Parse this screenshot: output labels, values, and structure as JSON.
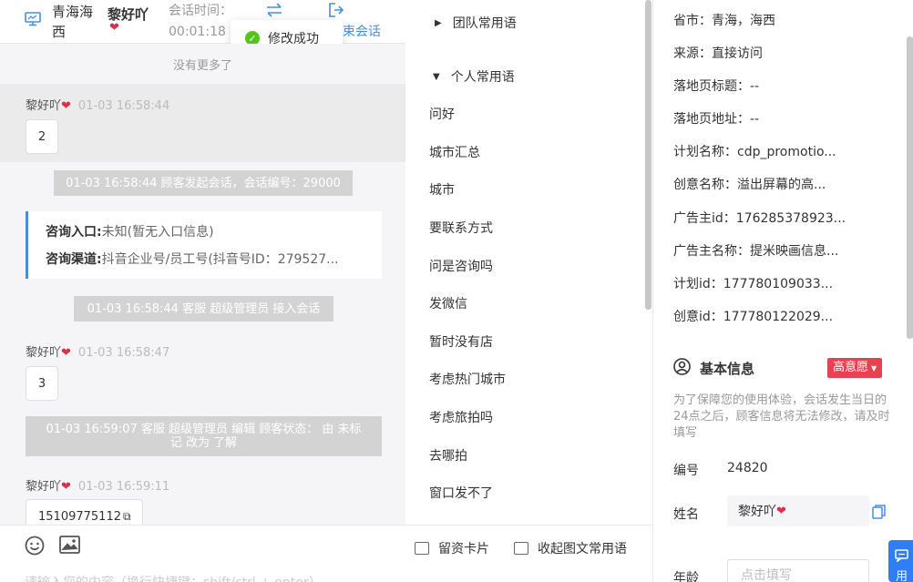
{
  "header": {
    "location": "青海海西",
    "customer_name": "黎好吖",
    "session_label": "会话时间：",
    "session_time": "00:01:18",
    "end_label": "束会话"
  },
  "toast": {
    "text": "修改成功"
  },
  "chat": {
    "no_more": "没有更多了",
    "messages": [
      {
        "sender": "黎好吖",
        "time": "01-03 16:58:44",
        "content": "2"
      },
      {
        "sender": "黎好吖",
        "time": "01-03 16:58:47",
        "content": "3"
      },
      {
        "sender": "黎好吖",
        "time": "01-03 16:59:11",
        "content": "15109775112"
      }
    ],
    "system": [
      "01-03 16:58:44 顾客发起会话，会话编号：29000",
      "01-03 16:58:44 客服 超级管理员 接入会话",
      "01-03 16:59:07 客服 超级管理员 编辑 顾客状态： 由 未标记 改为 了解"
    ],
    "card": {
      "entry_label": "咨询入口:",
      "entry_value": "未知(暂无入口信息)",
      "channel_label": "咨询渠道:",
      "channel_value": "抖音企业号/员工号(抖音号ID：279527..."
    }
  },
  "input": {
    "placeholder": "请输入您的内容（换行快捷键：shift/ctrl + enter）",
    "card_btn": "留资卡片",
    "collapse_btn": "收起图文常用语"
  },
  "phrases": {
    "team_group": "团队常用语",
    "personal_group": "个人常用语",
    "items": [
      "问好",
      "城市汇总",
      "城市",
      "要联系方式",
      "问是咨询吗",
      "发微信",
      "暂时没有店",
      "考虑热门城市",
      "考虑旅拍吗",
      "去哪拍",
      "窗口发不了"
    ]
  },
  "info": {
    "rows": [
      "省市：青海，海西",
      "来源：直接访问",
      "落地页标题：--",
      "落地页地址：--",
      "计划名称：cdp_promotio...",
      "创意名称：溢出屏幕的高...",
      "广告主id：176285378923...",
      "广告主名称：提米映画信息...",
      "计划id：177780109033...",
      "创意id：177780122029..."
    ],
    "basic_title": "基本信息",
    "intent_badge": "高意愿",
    "note": "为了保障您的使用体验，会话发生当日的24点之后，顾客信息将无法修改，请及时填写",
    "id_label": "编号",
    "id_value": "24820",
    "name_label": "姓名",
    "name_value": "黎好吖",
    "age_label": "年龄",
    "age_placeholder": "点击填写",
    "float_text": "用"
  },
  "colors": {
    "accent": "#4a8de0",
    "success": "#52c41a",
    "badge": "#e8414f"
  }
}
